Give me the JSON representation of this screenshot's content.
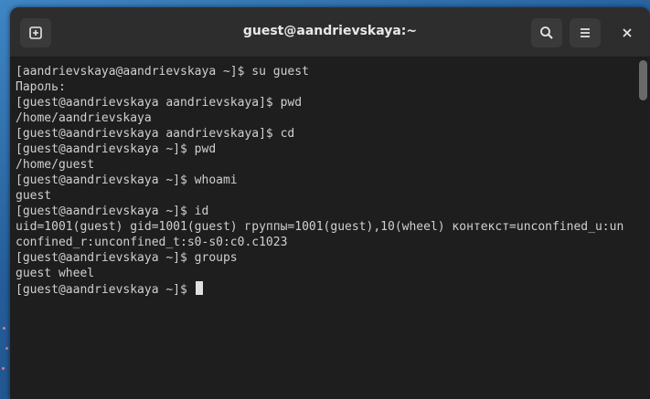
{
  "window": {
    "title": "guest@aandrievskaya:~"
  },
  "icons": {
    "new_tab": "new-tab-icon",
    "search": "search-icon",
    "menu": "hamburger-menu-icon",
    "close": "close-icon"
  },
  "colors": {
    "terminal_bg": "#1e1e1e",
    "titlebar_bg": "#2d2d2d",
    "text": "#d0d0d0"
  },
  "terminal": {
    "lines": [
      "[aandrievskaya@aandrievskaya ~]$ su guest",
      "Пароль:",
      "[guest@aandrievskaya aandrievskaya]$ pwd",
      "/home/aandrievskaya",
      "[guest@aandrievskaya aandrievskaya]$ cd",
      "[guest@aandrievskaya ~]$ pwd",
      "/home/guest",
      "[guest@aandrievskaya ~]$ whoami",
      "guest",
      "[guest@aandrievskaya ~]$ id",
      "uid=1001(guest) gid=1001(guest) группы=1001(guest),10(wheel) контекст=unconfined_u:un",
      "confined_r:unconfined_t:s0-s0:c0.c1023",
      "[guest@aandrievskaya ~]$ groups",
      "guest wheel",
      "[guest@aandrievskaya ~]$ "
    ]
  }
}
